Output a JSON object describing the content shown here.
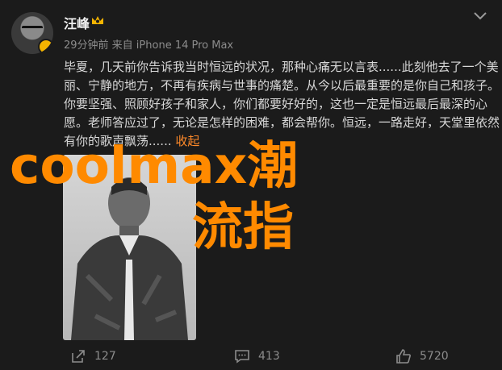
{
  "user": {
    "name": "汪峰",
    "meta": "29分钟前  来自 iPhone 14 Pro Max"
  },
  "post": {
    "text": "毕夏，几天前你告诉我当时恒远的状况，那种心痛无以言表......此刻他去了一个美丽、宁静的地方，不再有疾病与世事的痛楚。从今以后最重要的是你自己和孩子。你要坚强、照顾好孩子和家人，你们都要好好的，这也一定是恒远最后最深的心愿。老师答应过了，无论是怎样的困难，都会帮你。恒远，一路走好，天堂里依然有你的歌声飘荡......",
    "collapse_label": "收起"
  },
  "overlay": {
    "line1": "coolmax潮",
    "line2": "流指"
  },
  "actions": {
    "repost_count": "127",
    "comment_count": "413",
    "like_count": "5720"
  },
  "colors": {
    "background": "#1b1b1b",
    "accent": "#ff8a00",
    "muted": "#8c8c8c"
  },
  "icons": {
    "repost": "share-icon",
    "comment": "comment-icon",
    "like": "thumbs-up-icon",
    "menu": "chevron-down-icon"
  }
}
